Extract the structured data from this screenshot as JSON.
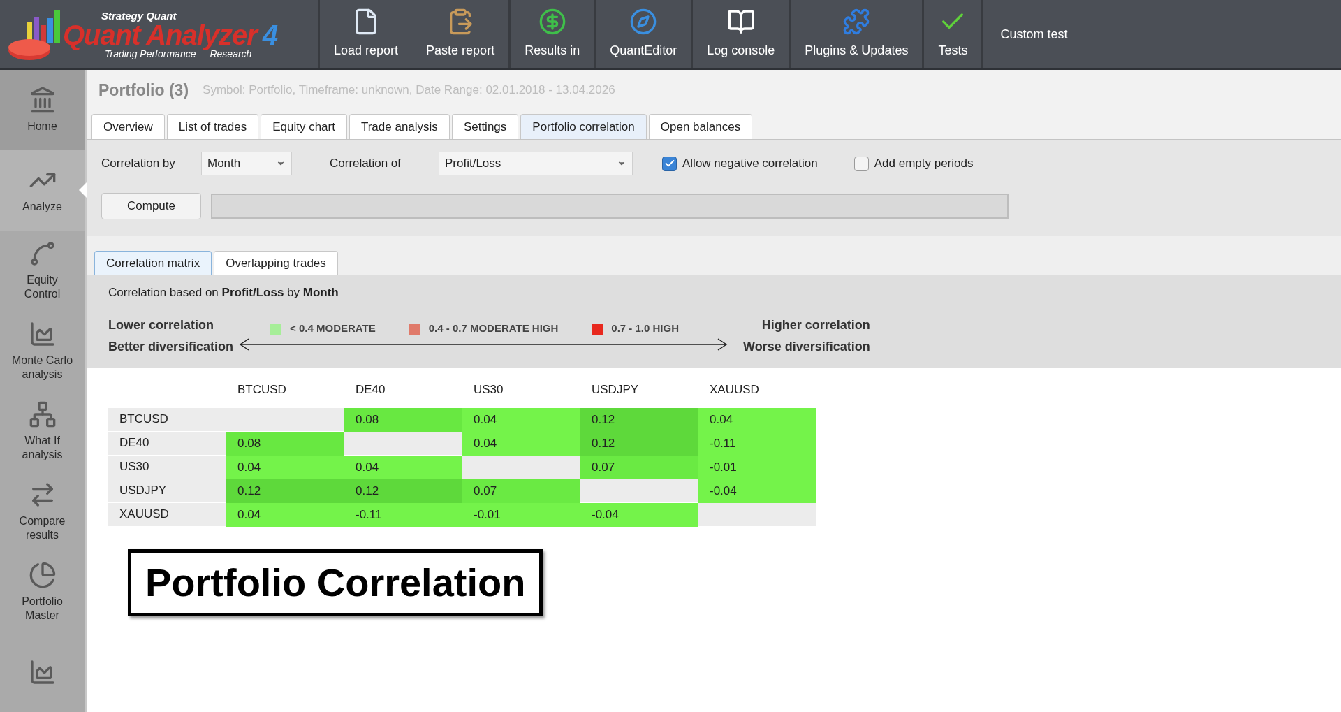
{
  "logo": {
    "brand": "Strategy Quant",
    "name": "Quant Analyzer",
    "version": "4",
    "tagline": "Trading Performance",
    "tagline_2": "Research"
  },
  "toolbar": [
    {
      "label": "Load report",
      "kind": "load"
    },
    {
      "label": "Paste report",
      "kind": "paste"
    },
    {
      "label": "Results in",
      "kind": "results"
    },
    {
      "label": "QuantEditor",
      "kind": "editor"
    },
    {
      "label": "Log console",
      "kind": "log"
    },
    {
      "label": "Plugins & Updates",
      "kind": "plugins"
    },
    {
      "label": "Tests",
      "kind": "tests"
    },
    {
      "label": "Custom test",
      "kind": "text"
    }
  ],
  "sidebar": {
    "items": [
      {
        "label": "Home",
        "kind": "home",
        "selected": false
      },
      {
        "label": "Analyze",
        "kind": "analyze",
        "selected": true
      },
      {
        "label": "Equity Control",
        "kind": "equity",
        "selected": false
      },
      {
        "label": "Monte Carlo analysis",
        "kind": "montecarlo",
        "selected": false
      },
      {
        "label": "What If analysis",
        "kind": "whatif",
        "selected": false
      },
      {
        "label": "Compare results",
        "kind": "compare",
        "selected": false
      },
      {
        "label": "Portfolio Master",
        "kind": "portfolio",
        "selected": false
      },
      {
        "kind": "chart",
        "selected": false
      }
    ]
  },
  "header": {
    "title": "Portfolio (3)",
    "info": "Symbol: Portfolio, Timeframe: unknown, Date Range: 02.01.2018 - 13.04.2026"
  },
  "tabs": [
    {
      "label": "Overview",
      "selected": false
    },
    {
      "label": "List of trades",
      "selected": false
    },
    {
      "label": "Equity chart",
      "selected": false
    },
    {
      "label": "Trade analysis",
      "selected": false
    },
    {
      "label": "Settings",
      "selected": false
    },
    {
      "label": "Portfolio correlation",
      "selected": true
    },
    {
      "label": "Open balances",
      "selected": false
    }
  ],
  "options": {
    "correlation_by_label": "Correlation by",
    "correlation_by": "Month",
    "correlation_of_label": "Correlation of",
    "correlation_of": "Profit/Loss",
    "checkboxes": [
      {
        "label": "Allow negative correlation",
        "checked": true
      },
      {
        "label": "Add empty periods",
        "checked": false
      }
    ],
    "compute_button": "Compute",
    "progress": {
      "level": 0
    }
  },
  "subtabs": [
    {
      "label": "Correlation matrix",
      "selected": true
    },
    {
      "label": "Overlapping trades",
      "selected": false
    }
  ],
  "summary": "Correlation based on **Profit/Loss** by **Month**",
  "legend": {
    "left_1": "Lower correlation",
    "left_2": "Better diversification",
    "right_1": "Higher correlation",
    "right_2": "Worse diversification",
    "items": [
      {
        "label": "< 0.4 MODERATE",
        "color": "#a6ee98"
      },
      {
        "label": "0.4 - 0.7 MODERATE HIGH",
        "color": "#e07a6a"
      },
      {
        "label": "0.7 - 1.0 HIGH",
        "color": "#e8281e"
      }
    ]
  },
  "matrix": {
    "columns": [
      "BTCUSD",
      "DE40",
      "US30",
      "USDJPY",
      "XAUUSD"
    ],
    "rows": [
      {
        "name": "BTCUSD",
        "cells": [
          {
            "kind": "blank"
          },
          {
            "value": "0.08",
            "color": "#68e841"
          },
          {
            "value": "0.04",
            "color": "#74f34a"
          },
          {
            "value": "0.12",
            "color": "#5ed93b"
          },
          {
            "value": "0.04",
            "color": "#74f34a"
          }
        ]
      },
      {
        "name": "DE40",
        "cells": [
          {
            "value": "0.08",
            "color": "#68e841"
          },
          {
            "kind": "blank"
          },
          {
            "value": "0.04",
            "color": "#74f34a"
          },
          {
            "value": "0.12",
            "color": "#5ed93b"
          },
          {
            "value": "-0.11",
            "color": "#74f34a"
          }
        ]
      },
      {
        "name": "US30",
        "cells": [
          {
            "value": "0.04",
            "color": "#74f34a"
          },
          {
            "value": "0.04",
            "color": "#74f34a"
          },
          {
            "kind": "blank"
          },
          {
            "value": "0.07",
            "color": "#6aea43"
          },
          {
            "value": "-0.01",
            "color": "#74f34a"
          }
        ]
      },
      {
        "name": "USDJPY",
        "cells": [
          {
            "value": "0.12",
            "color": "#5ed93b"
          },
          {
            "value": "0.12",
            "color": "#5ed93b"
          },
          {
            "value": "0.07",
            "color": "#6aea43"
          },
          {
            "kind": "blank"
          },
          {
            "value": "-0.04",
            "color": "#74f34a"
          }
        ]
      },
      {
        "name": "XAUUSD",
        "cells": [
          {
            "value": "0.04",
            "color": "#74f34a"
          },
          {
            "value": "-0.11",
            "color": "#74f34a"
          },
          {
            "value": "-0.01",
            "color": "#74f34a"
          },
          {
            "value": "-0.04",
            "color": "#74f34a"
          },
          {
            "kind": "blank"
          }
        ]
      }
    ]
  },
  "caption": "Portfolio Correlation"
}
